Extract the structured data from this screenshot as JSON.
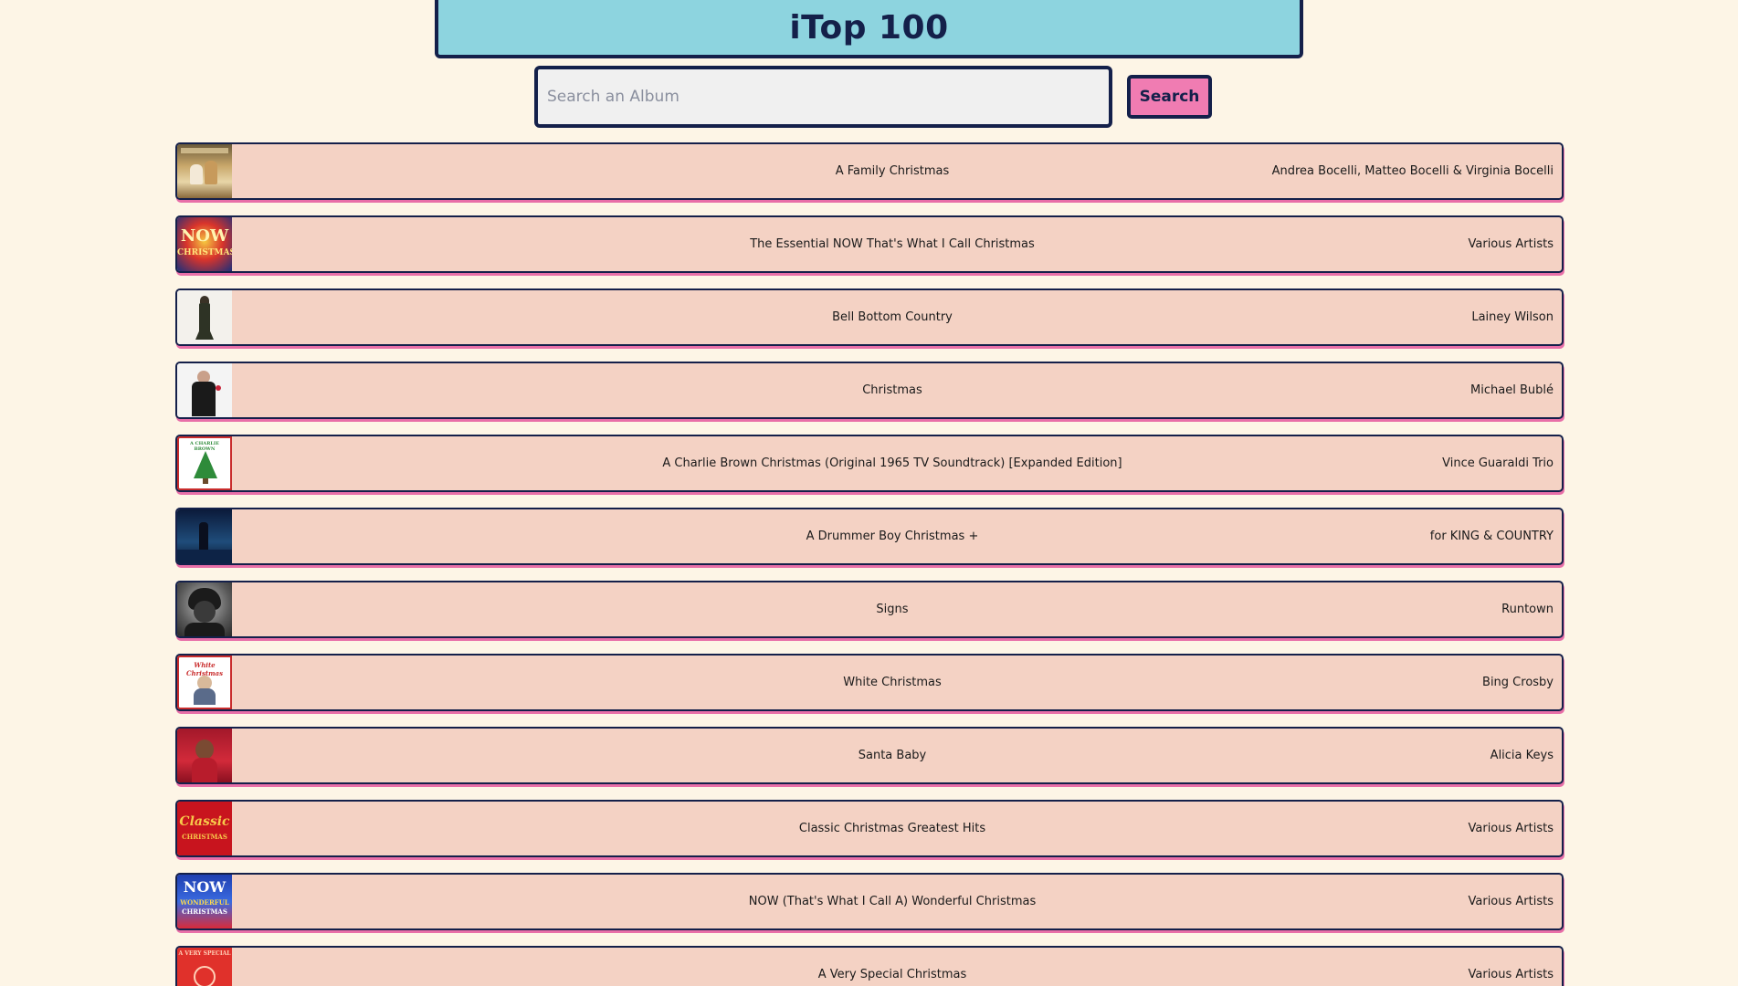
{
  "app": {
    "title": "iTop 100"
  },
  "search": {
    "placeholder": "Search an Album",
    "value": "",
    "button_label": "Search"
  },
  "colors": {
    "background": "#fdf5e6",
    "header": "#8dd4df",
    "row": "#f4d2c4",
    "accent_pink": "#f07cb2",
    "border_navy": "#14204a"
  },
  "albums": [
    {
      "title": "A Family Christmas",
      "artist": "Andrea Bocelli, Matteo Bocelli & Virginia Bocelli",
      "cover_icon": "album-cover-family-portrait"
    },
    {
      "title": "The Essential NOW That's What I Call Christmas",
      "artist": "Various Artists",
      "cover_icon": "album-cover-now-christmas"
    },
    {
      "title": "Bell Bottom Country",
      "artist": "Lainey Wilson",
      "cover_icon": "album-cover-standing-figure"
    },
    {
      "title": "Christmas",
      "artist": "Michael Bublé",
      "cover_icon": "album-cover-man-in-suit"
    },
    {
      "title": "A Charlie Brown Christmas (Original 1965 TV Soundtrack) [Expanded Edition]",
      "artist": "Vince Guaraldi Trio",
      "cover_icon": "album-cover-christmas-tree"
    },
    {
      "title": "A Drummer Boy Christmas +",
      "artist": "for KING & COUNTRY",
      "cover_icon": "album-cover-night-scene"
    },
    {
      "title": "Signs",
      "artist": "Runtown",
      "cover_icon": "album-cover-portrait-bw"
    },
    {
      "title": "White Christmas",
      "artist": "Bing Crosby",
      "cover_icon": "album-cover-white-christmas"
    },
    {
      "title": "Santa Baby",
      "artist": "Alicia Keys",
      "cover_icon": "album-cover-red-portrait"
    },
    {
      "title": "Classic Christmas Greatest Hits",
      "artist": "Various Artists",
      "cover_icon": "album-cover-classic-christmas"
    },
    {
      "title": "NOW (That's What I Call A) Wonderful Christmas",
      "artist": "Various Artists",
      "cover_icon": "album-cover-now-wonderful"
    },
    {
      "title": "A Very Special Christmas",
      "artist": "Various Artists",
      "cover_icon": "album-cover-very-special"
    }
  ]
}
